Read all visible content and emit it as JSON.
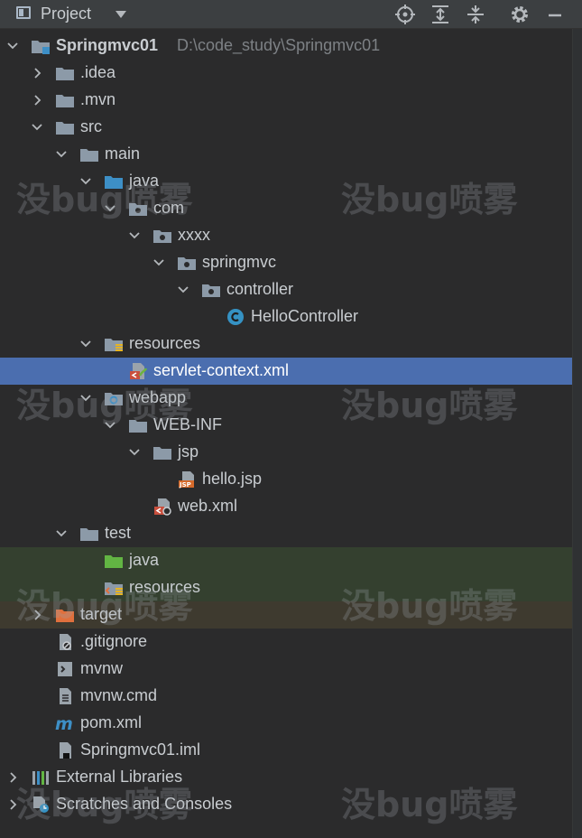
{
  "header": {
    "title": "Project",
    "toolbar": [
      "locate-icon",
      "expand-all-icon",
      "collapse-all-icon",
      "gear-icon",
      "minimize-icon"
    ]
  },
  "tree": [
    {
      "label": "Springmvc01",
      "path": "D:\\code_study\\Springmvc01",
      "depth": 0,
      "arrow": "down",
      "icon": "module-folder-icon",
      "bold": true
    },
    {
      "label": ".idea",
      "depth": 1,
      "arrow": "right",
      "icon": "folder-icon"
    },
    {
      "label": ".mvn",
      "depth": 1,
      "arrow": "right",
      "icon": "folder-icon"
    },
    {
      "label": "src",
      "depth": 1,
      "arrow": "down",
      "icon": "folder-icon"
    },
    {
      "label": "main",
      "depth": 2,
      "arrow": "down",
      "icon": "folder-icon"
    },
    {
      "label": "java",
      "depth": 3,
      "arrow": "down",
      "icon": "source-root-folder-icon"
    },
    {
      "label": "com",
      "depth": 4,
      "arrow": "down",
      "icon": "package-icon"
    },
    {
      "label": "xxxx",
      "depth": 5,
      "arrow": "down",
      "icon": "package-icon"
    },
    {
      "label": "springmvc",
      "depth": 6,
      "arrow": "down",
      "icon": "package-icon"
    },
    {
      "label": "controller",
      "depth": 7,
      "arrow": "down",
      "icon": "package-icon"
    },
    {
      "label": "HelloController",
      "depth": 8,
      "arrow": "none",
      "icon": "java-class-icon"
    },
    {
      "label": "resources",
      "depth": 3,
      "arrow": "down",
      "icon": "resources-folder-icon"
    },
    {
      "label": "servlet-context.xml",
      "depth": 4,
      "arrow": "none",
      "icon": "spring-xml-icon",
      "selected": true
    },
    {
      "label": "webapp",
      "depth": 3,
      "arrow": "down",
      "icon": "web-folder-icon"
    },
    {
      "label": "WEB-INF",
      "depth": 4,
      "arrow": "down",
      "icon": "folder-icon"
    },
    {
      "label": "jsp",
      "depth": 5,
      "arrow": "down",
      "icon": "folder-icon"
    },
    {
      "label": "hello.jsp",
      "depth": 6,
      "arrow": "none",
      "icon": "jsp-file-icon"
    },
    {
      "label": "web.xml",
      "depth": 5,
      "arrow": "none",
      "icon": "web-xml-icon"
    },
    {
      "label": "test",
      "depth": 2,
      "arrow": "down",
      "icon": "folder-icon"
    },
    {
      "label": "java",
      "depth": 3,
      "arrow": "none",
      "icon": "test-source-folder-icon"
    },
    {
      "label": "resources",
      "depth": 3,
      "arrow": "none",
      "icon": "test-resources-folder-icon"
    },
    {
      "label": "target",
      "depth": 1,
      "arrow": "right",
      "icon": "excluded-folder-icon"
    },
    {
      "label": ".gitignore",
      "depth": 1,
      "arrow": "none",
      "icon": "ignore-file-icon"
    },
    {
      "label": "mvnw",
      "depth": 1,
      "arrow": "none",
      "icon": "shell-file-icon"
    },
    {
      "label": "mvnw.cmd",
      "depth": 1,
      "arrow": "none",
      "icon": "text-file-icon"
    },
    {
      "label": "pom.xml",
      "depth": 1,
      "arrow": "none",
      "icon": "maven-icon"
    },
    {
      "label": "Springmvc01.iml",
      "depth": 1,
      "arrow": "none",
      "icon": "iml-file-icon"
    },
    {
      "label": "External Libraries",
      "depth": 0,
      "arrow": "right",
      "icon": "libraries-icon"
    },
    {
      "label": "Scratches and Consoles",
      "depth": 0,
      "arrow": "right",
      "icon": "scratches-icon"
    }
  ],
  "watermark": {
    "text": "没bug喷雾"
  },
  "colors": {
    "background": "#2b2b2c",
    "header": "#3c3f41",
    "selection": "#4b6eaf",
    "test_band": "#34402f",
    "excluded_band": "#3e3a2f",
    "folder": "#8c9aa8",
    "source_folder": "#3d8fc6",
    "test_folder": "#62b543",
    "excluded_folder": "#e0703d"
  }
}
